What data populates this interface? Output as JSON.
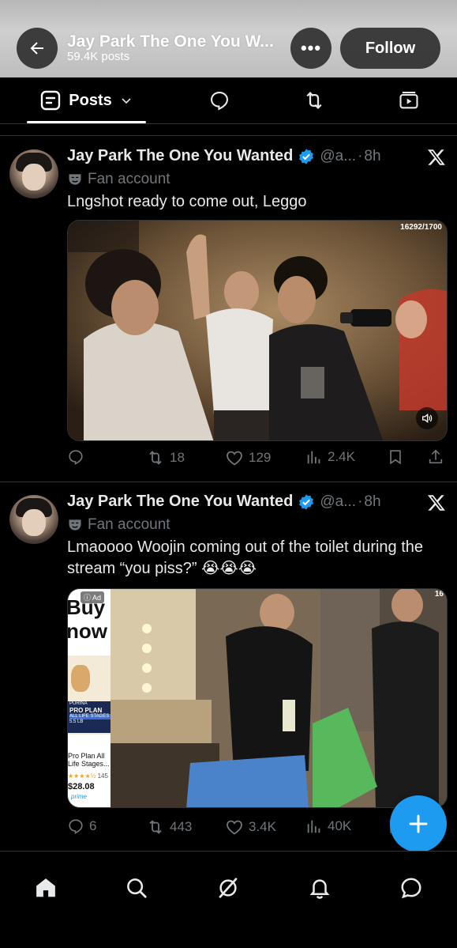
{
  "header": {
    "title": "Jay Park The One You W...",
    "posts_count": "59.4K posts",
    "follow_label": "Follow",
    "more_label": "•••"
  },
  "tabs": {
    "active_label": "Posts",
    "items": [
      "posts",
      "replies",
      "reposts",
      "media"
    ]
  },
  "tweets": [
    {
      "name": "Jay Park The One You Wanted",
      "handle": "@a...",
      "time": "8h",
      "badge": "Fan account",
      "text": "Lngshot ready to come out, Leggo",
      "media_counter": "16292/1700",
      "stats": {
        "replies": "",
        "reposts": "18",
        "likes": "129",
        "views": "2.4K"
      }
    },
    {
      "name": "Jay Park The One You Wanted",
      "handle": "@a...",
      "time": "8h",
      "badge": "Fan account",
      "text": "Lmaoooo Woojin coming out of the toilet during the stream “you piss?” 😭😭😭",
      "media_counter": "16",
      "ad": {
        "label": "Ad",
        "headline_1": "Buy",
        "headline_2": "now",
        "brand": "PURINA",
        "product": "PRO PLAN",
        "stage": "ALL LIFE STAGES",
        "weight": "5.5 LB",
        "title": "Pro Plan All Life Stages...",
        "rating_count": "145",
        "price": "$28.08",
        "prime": "prime"
      },
      "stats": {
        "replies": "6",
        "reposts": "443",
        "likes": "3.4K",
        "views": "40K"
      }
    }
  ],
  "colors": {
    "accent": "#1d9bf0",
    "muted": "#71767b",
    "text": "#e7e9ea",
    "background": "#000000"
  },
  "bottom_nav": [
    "home-icon",
    "search-icon",
    "grok-icon",
    "notifications-icon",
    "messages-icon"
  ]
}
